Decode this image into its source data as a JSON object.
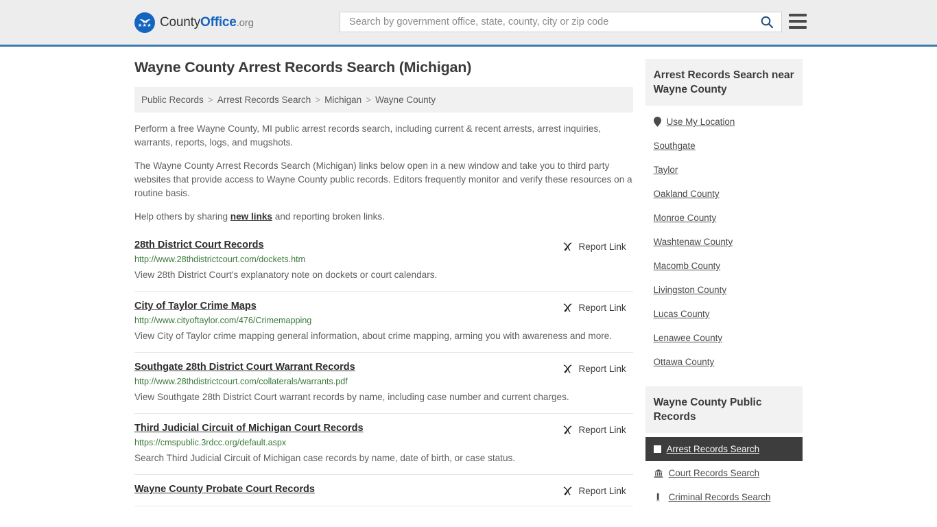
{
  "header": {
    "logo_text_1": "County",
    "logo_text_2": "Office",
    "logo_text_3": ".org",
    "logo_icon": "eagle-shield-icon",
    "search_placeholder": "Search by government office, state, county, city or zip code",
    "search_value": "",
    "search_icon": "search-icon",
    "menu_icon": "hamburger-menu-icon"
  },
  "main": {
    "title": "Wayne County Arrest Records Search (Michigan)",
    "breadcrumb": [
      "Public Records",
      "Arrest Records Search",
      "Michigan",
      "Wayne County"
    ],
    "breadcrumb_separator": ">",
    "intro_paragraph_1": "Perform a free Wayne County, MI public arrest records search, including current & recent arrests, arrest inquiries, warrants, reports, logs, and mugshots.",
    "intro_paragraph_2": "The Wayne County Arrest Records Search (Michigan) links below open in a new window and take you to third party websites that provide access to Wayne County public records. Editors frequently monitor and verify these resources on a routine basis.",
    "help_prefix": "Help others by sharing ",
    "help_link": "new links",
    "help_suffix": " and reporting broken links.",
    "report_label": "Report Link",
    "report_icon": "broken-link-icon",
    "links": [
      {
        "title": "28th District Court Records",
        "url": "http://www.28thdistrictcourt.com/dockets.htm",
        "description": "View 28th District Court's explanatory note on dockets or court calendars."
      },
      {
        "title": "City of Taylor Crime Maps",
        "url": "http://www.cityoftaylor.com/476/Crimemapping",
        "description": "View City of Taylor crime mapping general information, about crime mapping, arming you with awareness and more."
      },
      {
        "title": "Southgate 28th District Court Warrant Records",
        "url": "http://www.28thdistrictcourt.com/collaterals/warrants.pdf",
        "description": "View Southgate 28th District Court warrant records by name, including case number and current charges."
      },
      {
        "title": "Third Judicial Circuit of Michigan Court Records",
        "url": "https://cmspublic.3rdcc.org/default.aspx",
        "description": "Search Third Judicial Circuit of Michigan case records by name, date of birth, or case status."
      },
      {
        "title": "Wayne County Probate Court Records",
        "url": "",
        "description": ""
      }
    ]
  },
  "sidebar": {
    "nearby": {
      "heading": "Arrest Records Search near Wayne County",
      "use_my_location": "Use My Location",
      "location_icon": "map-pin-icon",
      "items": [
        "Southgate",
        "Taylor",
        "Oakland County",
        "Monroe County",
        "Washtenaw County",
        "Macomb County",
        "Livingston County",
        "Lucas County",
        "Lenawee County",
        "Ottawa County"
      ]
    },
    "public_records": {
      "heading": "Wayne County Public Records",
      "items": [
        {
          "label": "Arrest Records Search",
          "icon": "square-icon",
          "active": true
        },
        {
          "label": "Court Records Search",
          "icon": "bank-building-icon",
          "active": false
        },
        {
          "label": "Criminal Records Search",
          "icon": "document-icon",
          "active": false
        }
      ]
    }
  },
  "colors": {
    "header_bg": "#ededed",
    "header_border": "#3a7ab0",
    "brand_blue": "#1565c0",
    "url_green": "#3a7a3a",
    "active_bg": "#3d3d3d"
  }
}
